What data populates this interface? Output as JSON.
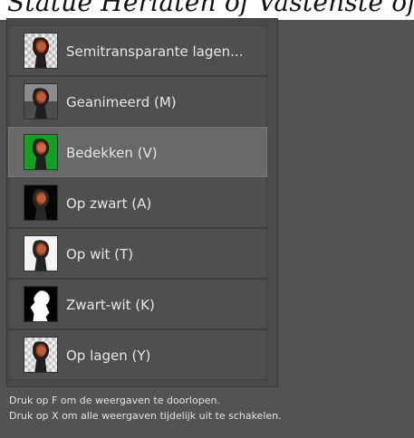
{
  "header": {
    "fragment": "Statue Herlaten of Vastenste of"
  },
  "view_modes": [
    {
      "label": "Semitransparante lagen...",
      "active": false
    },
    {
      "label": "Geanimeerd (M)",
      "active": false
    },
    {
      "label": "Bedekken (V)",
      "active": true
    },
    {
      "label": "Op zwart (A)",
      "active": false
    },
    {
      "label": "Op wit (T)",
      "active": false
    },
    {
      "label": "Zwart-wit (K)",
      "active": false
    },
    {
      "label": "Op lagen (Y)",
      "active": false
    }
  ],
  "help": {
    "line1": "Druk op F om de weergaven te doorlopen.",
    "line2": "Druk op X om alle weergaven tijdelijk uit te schakelen."
  },
  "colors": {
    "background": "#535353",
    "panel": "#4a4a4a",
    "item": "#4f4f4f",
    "active_item": "#686868",
    "text": "#e6e6e6",
    "green_screen": "#14a020"
  }
}
